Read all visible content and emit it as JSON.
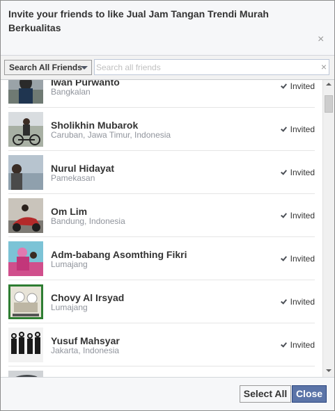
{
  "dialog": {
    "title": "Invite your friends to like Jual Jam Tangan Trendi Murah Berkualitas",
    "close_icon": "×"
  },
  "toolbar": {
    "filter_label": "Search All Friends",
    "search_placeholder": "Search all friends",
    "clear_icon": "×"
  },
  "friends": [
    {
      "name": "Iwan Purwanto",
      "location": "Bangkalan",
      "status": "Invited"
    },
    {
      "name": "Sholikhin Mubarok",
      "location": "Caruban, Jawa Timur, Indonesia",
      "status": "Invited"
    },
    {
      "name": "Nurul Hidayat",
      "location": "Pamekasan",
      "status": "Invited"
    },
    {
      "name": "Om Lim",
      "location": "Bandung, Indonesia",
      "status": "Invited"
    },
    {
      "name": "Adm-babang Asomthing Fikri",
      "location": "Lumajang",
      "status": "Invited"
    },
    {
      "name": "Chovy Al Irsyad",
      "location": "Lumajang",
      "status": "Invited"
    },
    {
      "name": "Yusuf Mahsyar",
      "location": "Jakarta, Indonesia",
      "status": "Invited"
    },
    {
      "name": "",
      "location": "",
      "status": ""
    }
  ],
  "footer": {
    "select_all_label": "Select All",
    "close_label": "Close"
  },
  "colors": {
    "primary_button": "#5b74a8",
    "header_bg": "#f6f7f9"
  }
}
